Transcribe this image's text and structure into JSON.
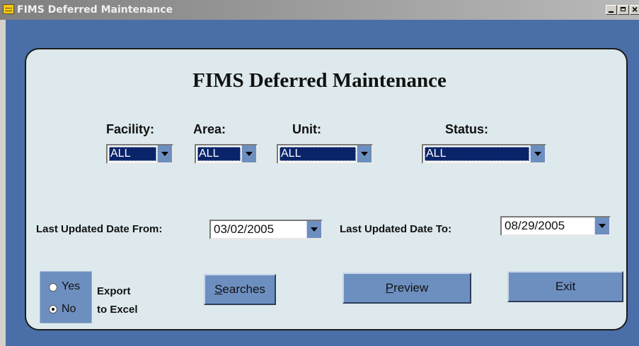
{
  "window": {
    "title": "FIMS Deferred Maintenance"
  },
  "form": {
    "heading": "FIMS Deferred Maintenance",
    "filters": {
      "facility": {
        "label": "Facility:",
        "value": "ALL"
      },
      "area": {
        "label": "Area:",
        "value": "ALL"
      },
      "unit": {
        "label": "Unit:",
        "value": "ALL"
      },
      "status": {
        "label": "Status:",
        "value": "ALL"
      }
    },
    "date_from": {
      "label": "Last Updated Date From:",
      "value": "03/02/2005"
    },
    "date_to": {
      "label": "Last Updated Date To:",
      "value": "08/29/2005"
    },
    "export": {
      "label_line1": "Export",
      "label_line2": "to Excel",
      "options": [
        {
          "label": "Yes",
          "checked": false
        },
        {
          "label": "No",
          "checked": true
        }
      ]
    },
    "buttons": {
      "searches": {
        "mnemonic": "S",
        "rest": "earches"
      },
      "preview": {
        "mnemonic": "P",
        "rest": "review"
      },
      "exit": "Exit"
    }
  },
  "colors": {
    "title_bar": "#8a8a8a",
    "client_bg": "#4a6fa8",
    "panel_bg": "#dde9ec",
    "button_bg": "#6d8fc0",
    "selection": "#0a246a"
  },
  "icons": [
    "form-icon",
    "minimize-icon",
    "maximize-icon",
    "close-icon",
    "dropdown-arrow-icon"
  ]
}
